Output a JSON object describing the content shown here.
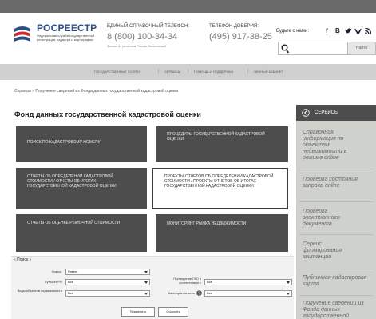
{
  "header": {
    "logo_name": "РОСРЕЕСТР",
    "logo_sub": "Федеральная служба государственной регистрации, кадастра и картографии",
    "helpline": {
      "label": "ЕДИНЫЙ СПРАВОЧНЫЙ ТЕЛЕФОН:",
      "phone": "8 (800) 100-34-34",
      "note": "Звонок из регионов России бесплатный"
    },
    "trustline": {
      "label": "ТЕЛЕФОН ДОВЕРИЯ:",
      "phone": "(495) 917-38-25"
    },
    "social_label": "Будьте с нами:",
    "social_icons": [
      "f",
      "B",
      "t",
      "vk",
      "rss"
    ],
    "search_button": "Найти"
  },
  "nav": {
    "items": [
      "ГОСУДАРСТВЕННЫЕ УСЛУГИ",
      "СЕРВИСЫ",
      "ПОМОЩЬ И ПОДДЕРЖКА",
      "ЛИЧНЫЙ КАБИНЕТ"
    ],
    "separator": "|"
  },
  "breadcrumb": "Сервисы  >  Получение сведений из Фонда данных государственной кадастровой оценки",
  "page_title": "Фонд данных государственной кадастровой оценки",
  "tiles": [
    {
      "label": "ПОИСК ПО КАДАСТРОВОМУ НОМЕРУ",
      "active": false
    },
    {
      "label": "ПРОЦЕДУРЫ ГОСУДАРСТВЕННОЙ КАДАСТРОВОЙ ОЦЕНКИ",
      "active": false
    },
    {
      "label": "ОТЧЕТЫ ОБ ОПРЕДЕЛЕНИИ КАДАСТРОВОЙ СТОИМОСТИ / ОТЧЕТЫ ОБ ИТОГАХ ГОСУДАРСТВЕННОЙ КАДАСТРОВОЙ ОЦЕНКИ",
      "active": false
    },
    {
      "label": "ПРОЕКТЫ ОТЧЕТОВ ОБ ОПРЕДЕЛЕНИИ КАДАСТРОВОЙ СТОИМОСТИ / ПРОЕКТЫ ОТЧЕТОВ ОБ ИТОГАХ ГОСУДАРСТВЕННОЙ КАДАСТРОВОЙ ОЦЕНКИ",
      "active": true
    },
    {
      "label": "ОТЧЕТЫ ОБ ОЦЕНКЕ РЫНОЧНОЙ СТОИМОСТИ",
      "active": false
    },
    {
      "label": "МОНИТОРИНГ РЫНКА НЕДВИЖИМОСТИ",
      "active": false
    }
  ],
  "sidebar": {
    "heading": "СЕРВИСЫ",
    "links": [
      "Справочная информация по объектам недвижимости в режиме online",
      "Проверка состояния запроса online",
      "Проверка электронного документа",
      "Сервис формирования квитанции",
      "Публичная кадастровая карта",
      "Получение сведений из Фонда данных государственной"
    ]
  },
  "search_form": {
    "title": "« Поиск »",
    "number_label": "Номер:",
    "number_value": "Равен",
    "subject_label": "Субъект РФ",
    "subject_value": "Все",
    "objtype_label": "Виды объектов недвижимости",
    "objtype_value": "Все",
    "gko_label": "Проведение ГКО в соответствии с",
    "gko_value": "Все",
    "category_label": "Категории земель",
    "category_value": "Все",
    "apply_button": "Применить",
    "clear_button": "Очистить"
  },
  "colors": {
    "brand_blue": "#2a4e86",
    "tile_dark": "#4d4d4d",
    "sidebar_bg": "#cfd1cc",
    "nav_bg": "#cfcfcf"
  }
}
